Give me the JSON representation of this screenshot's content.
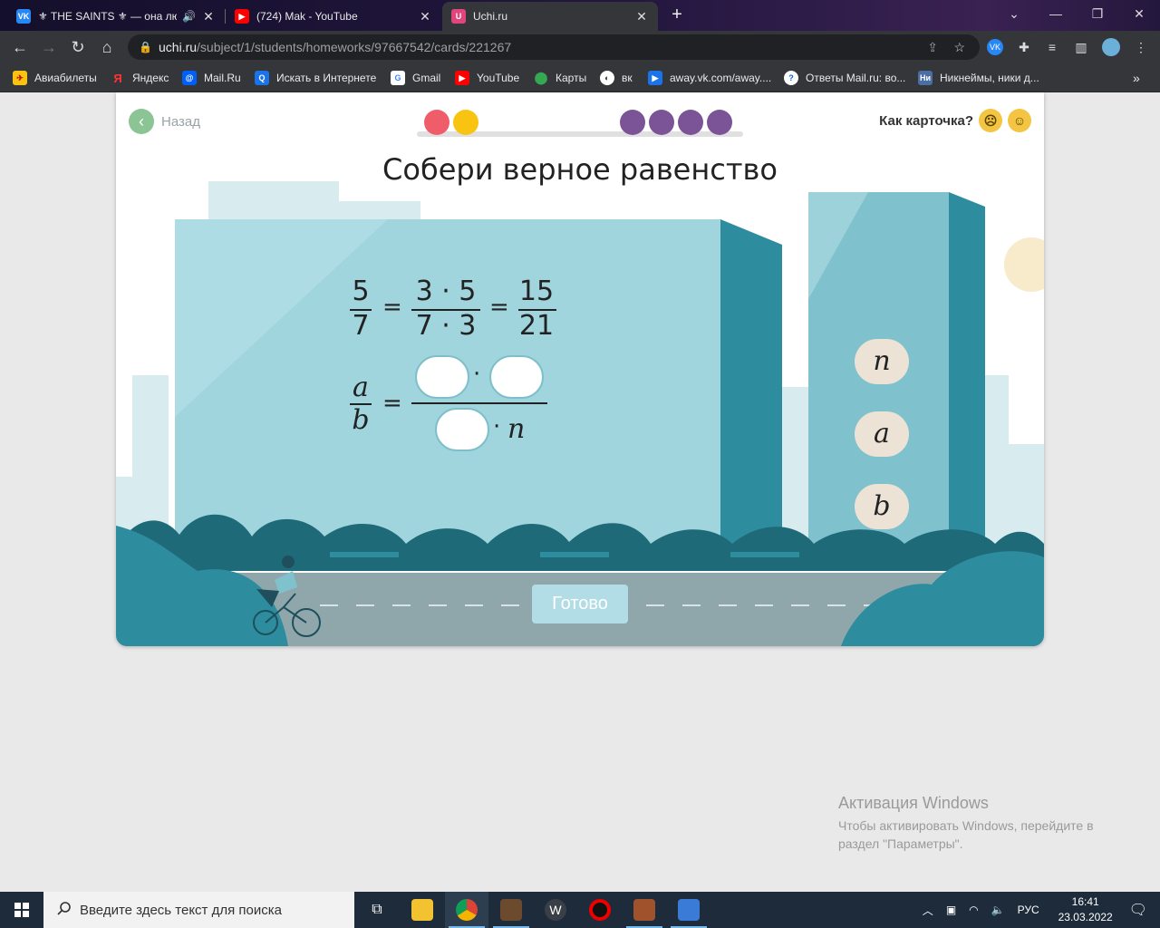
{
  "browser": {
    "tabs": [
      {
        "title": "⚜ THE SAINTS ⚜ — она люб",
        "favicon": "vk-icon"
      },
      {
        "title": "(724) Mak - YouTube",
        "favicon": "youtube-icon"
      },
      {
        "title": "Uchi.ru",
        "favicon": "uchi-icon"
      }
    ],
    "url_host": "uchi.ru",
    "url_path": "/subject/1/students/homeworks/97667542/cards/221267",
    "bookmarks": [
      {
        "label": "Авиабилеты",
        "icon": "plane-icon"
      },
      {
        "label": "Яндекс",
        "icon": "yandex-icon"
      },
      {
        "label": "Mail.Ru",
        "icon": "mail-icon"
      },
      {
        "label": "Искать в Интернете",
        "icon": "search-icon"
      },
      {
        "label": "Gmail",
        "icon": "google-icon"
      },
      {
        "label": "YouTube",
        "icon": "youtube-icon"
      },
      {
        "label": "Карты",
        "icon": "maps-icon"
      },
      {
        "label": "вк",
        "icon": "globe-icon"
      },
      {
        "label": "away.vk.com/away....",
        "icon": "play-icon"
      },
      {
        "label": "Ответы Mail.ru: во...",
        "icon": "question-icon"
      },
      {
        "label": "Никнеймы, ники д...",
        "icon": "nick-icon"
      }
    ]
  },
  "card": {
    "back_label": "Назад",
    "rate_label": "Как карточка?",
    "title": "Собери верное равенство",
    "progress_colors": [
      "#ef5d6b",
      "#f9c312",
      "#7a5496",
      "#7a5496",
      "#7a5496",
      "#7a5496"
    ],
    "example": {
      "f1_num": "5",
      "f1_den": "7",
      "f2_num": "3 · 5",
      "f2_den": "7 · 3",
      "f3_num": "15",
      "f3_den": "21",
      "eq": "="
    },
    "task": {
      "num": "a",
      "den": "b",
      "eq": "=",
      "dot": "·",
      "den_tail": "n"
    },
    "tiles": [
      "n",
      "a",
      "b"
    ],
    "done_label": "Готово"
  },
  "watermark": {
    "heading": "Активация Windows",
    "line1": "Чтобы активировать Windows, перейдите в",
    "line2": "раздел \"Параметры\"."
  },
  "taskbar": {
    "search_placeholder": "Введите здесь текст для поиска",
    "language": "РУС",
    "time": "16:41",
    "date": "23.03.2022"
  }
}
